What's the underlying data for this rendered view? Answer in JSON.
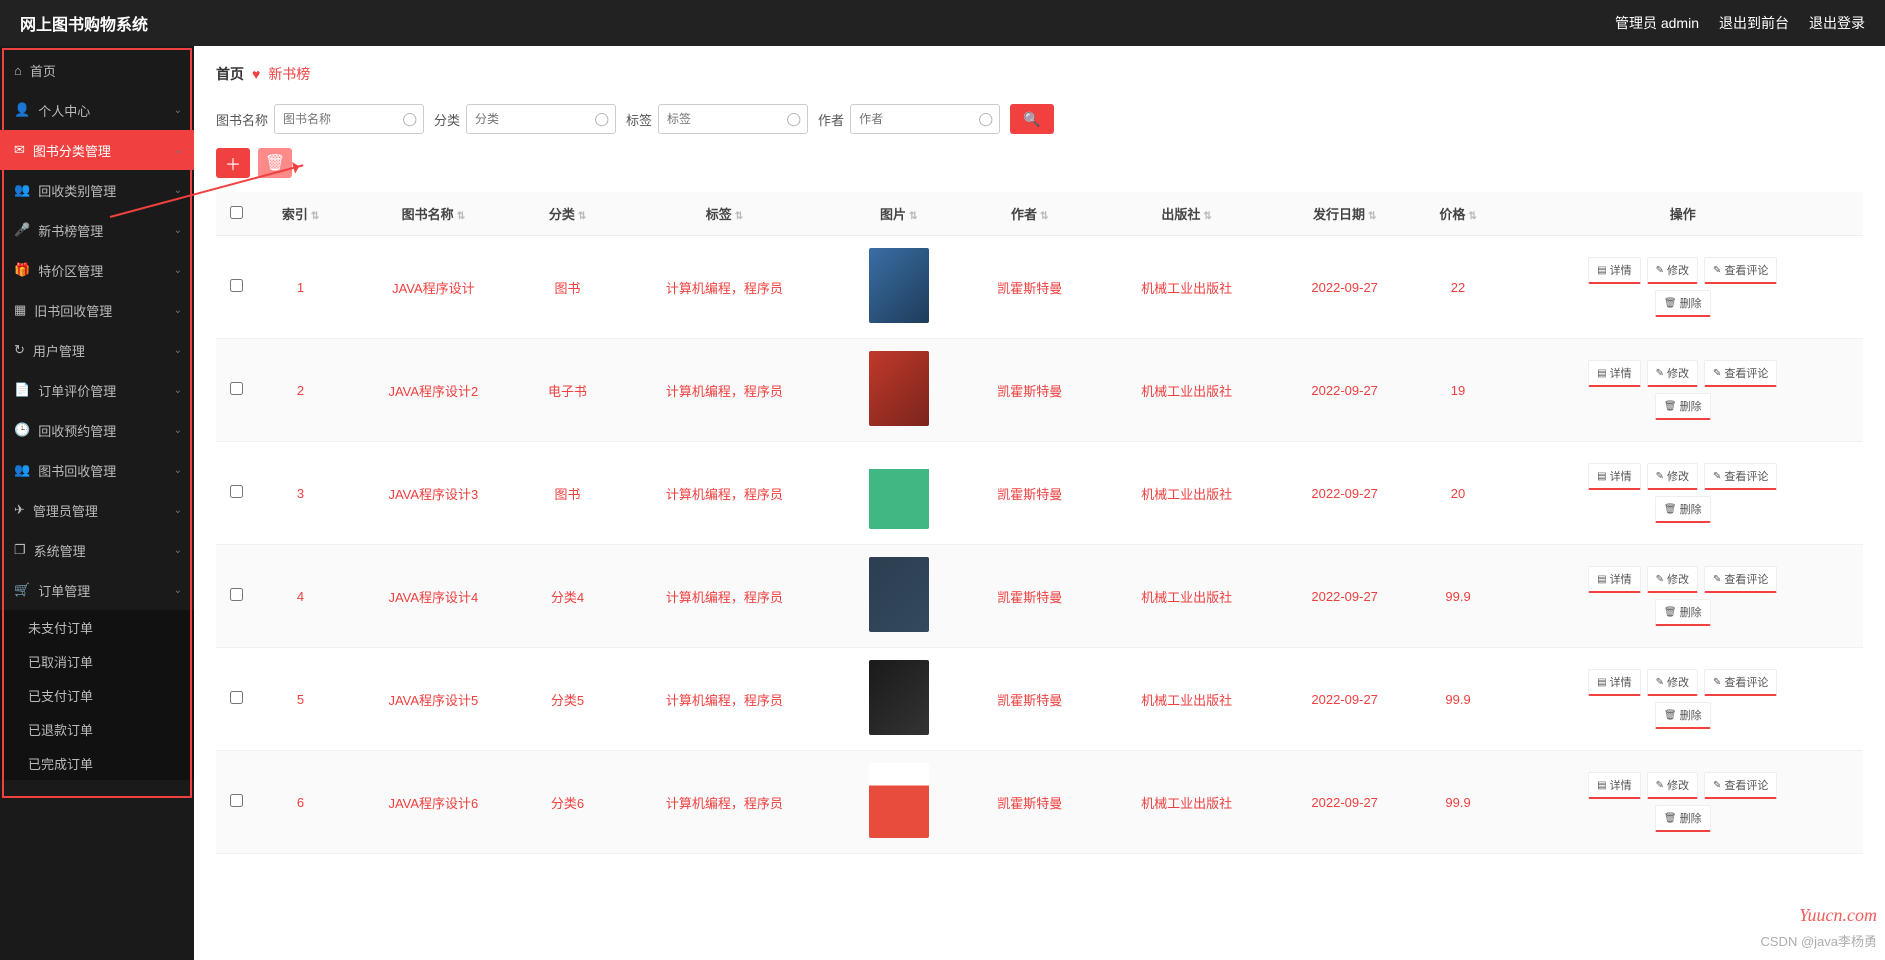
{
  "header": {
    "brand": "网上图书购物系统",
    "admin_label": "管理员 admin",
    "to_front": "退出到前台",
    "logout": "退出登录"
  },
  "sidebar": {
    "items": [
      {
        "icon": "home",
        "label": "首页",
        "chev": false
      },
      {
        "icon": "user",
        "label": "个人中心",
        "chev": true
      },
      {
        "icon": "mail",
        "label": "图书分类管理",
        "chev": true,
        "active": true
      },
      {
        "icon": "users",
        "label": "回收类别管理",
        "chev": true
      },
      {
        "icon": "mic",
        "label": "新书榜管理",
        "chev": true
      },
      {
        "icon": "gift",
        "label": "特价区管理",
        "chev": true
      },
      {
        "icon": "grid",
        "label": "旧书回收管理",
        "chev": true
      },
      {
        "icon": "refresh",
        "label": "用户管理",
        "chev": true
      },
      {
        "icon": "doc",
        "label": "订单评价管理",
        "chev": true
      },
      {
        "icon": "clock",
        "label": "回收预约管理",
        "chev": true
      },
      {
        "icon": "users",
        "label": "图书回收管理",
        "chev": true
      },
      {
        "icon": "send",
        "label": "管理员管理",
        "chev": true
      },
      {
        "icon": "window",
        "label": "系统管理",
        "chev": true
      },
      {
        "icon": "cart",
        "label": "订单管理",
        "chev": true
      }
    ],
    "sub_order": [
      "未支付订单",
      "已取消订单",
      "已支付订单",
      "已退款订单",
      "已完成订单"
    ]
  },
  "crumb": {
    "home": "首页",
    "current": "新书榜"
  },
  "filters": {
    "book_name_label": "图书名称",
    "book_name_ph": "图书名称",
    "category_label": "分类",
    "category_ph": "分类",
    "tag_label": "标签",
    "tag_ph": "标签",
    "author_label": "作者",
    "author_ph": "作者"
  },
  "columns": [
    "",
    "索引",
    "图书名称",
    "分类",
    "标签",
    "图片",
    "作者",
    "出版社",
    "发行日期",
    "价格",
    "操作"
  ],
  "rows": [
    {
      "idx": "1",
      "name": "JAVA程序设计",
      "cat": "图书",
      "tag": "计算机编程，程序员",
      "author": "凯霍斯特曼",
      "pub": "机械工业出版社",
      "date": "2022-09-27",
      "price": "22",
      "img": "g1"
    },
    {
      "idx": "2",
      "name": "JAVA程序设计2",
      "cat": "电子书",
      "tag": "计算机编程，程序员",
      "author": "凯霍斯特曼",
      "pub": "机械工业出版社",
      "date": "2022-09-27",
      "price": "19",
      "img": "g2"
    },
    {
      "idx": "3",
      "name": "JAVA程序设计3",
      "cat": "图书",
      "tag": "计算机编程，程序员",
      "author": "凯霍斯特曼",
      "pub": "机械工业出版社",
      "date": "2022-09-27",
      "price": "20",
      "img": "g3"
    },
    {
      "idx": "4",
      "name": "JAVA程序设计4",
      "cat": "分类4",
      "tag": "计算机编程，程序员",
      "author": "凯霍斯特曼",
      "pub": "机械工业出版社",
      "date": "2022-09-27",
      "price": "99.9",
      "img": "g4"
    },
    {
      "idx": "5",
      "name": "JAVA程序设计5",
      "cat": "分类5",
      "tag": "计算机编程，程序员",
      "author": "凯霍斯特曼",
      "pub": "机械工业出版社",
      "date": "2022-09-27",
      "price": "99.9",
      "img": "g5"
    },
    {
      "idx": "6",
      "name": "JAVA程序设计6",
      "cat": "分类6",
      "tag": "计算机编程，程序员",
      "author": "凯霍斯特曼",
      "pub": "机械工业出版社",
      "date": "2022-09-27",
      "price": "99.9",
      "img": "g6"
    }
  ],
  "ops": {
    "detail": "详情",
    "edit": "修改",
    "comments": "查看评论",
    "delete": "删除"
  },
  "watermark1": "Yuucn.com",
  "watermark2": "CSDN @java李杨勇"
}
